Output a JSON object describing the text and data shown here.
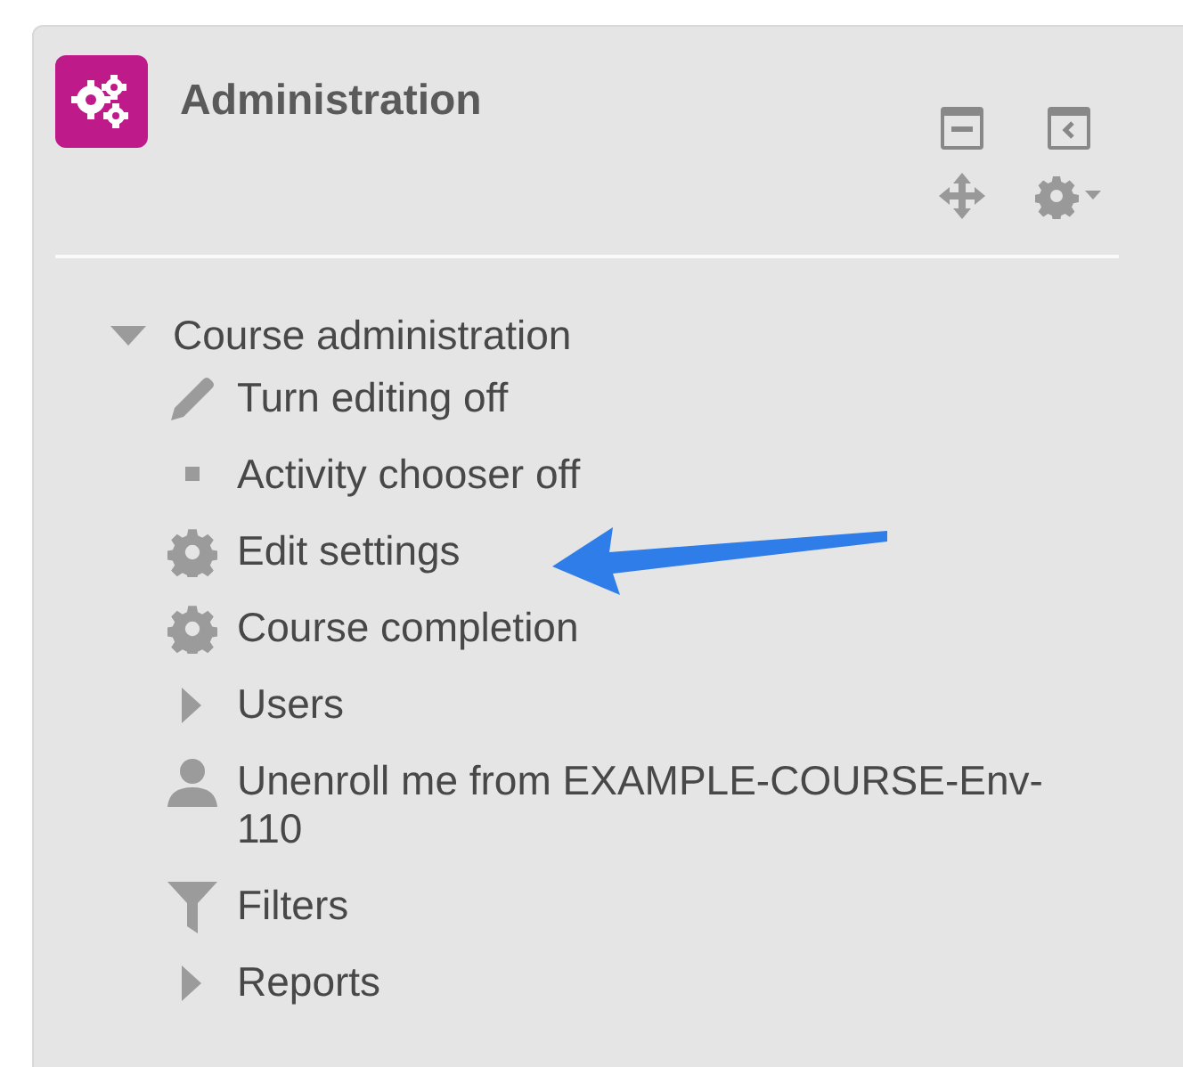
{
  "block": {
    "title": "Administration"
  },
  "tree": {
    "label": "Course administration",
    "expanded": true,
    "children": [
      {
        "label": "Turn editing off",
        "kind": "pencil"
      },
      {
        "label": "Activity chooser off",
        "kind": "square"
      },
      {
        "label": "Edit settings",
        "kind": "gear"
      },
      {
        "label": "Course completion",
        "kind": "gear"
      },
      {
        "label": "Users",
        "kind": "branch",
        "expanded": false
      },
      {
        "label": "Unenroll me from EXAMPLE-COURSE-Env-110",
        "kind": "person"
      },
      {
        "label": "Filters",
        "kind": "filter"
      },
      {
        "label": "Reports",
        "kind": "branch",
        "expanded": false
      }
    ]
  }
}
